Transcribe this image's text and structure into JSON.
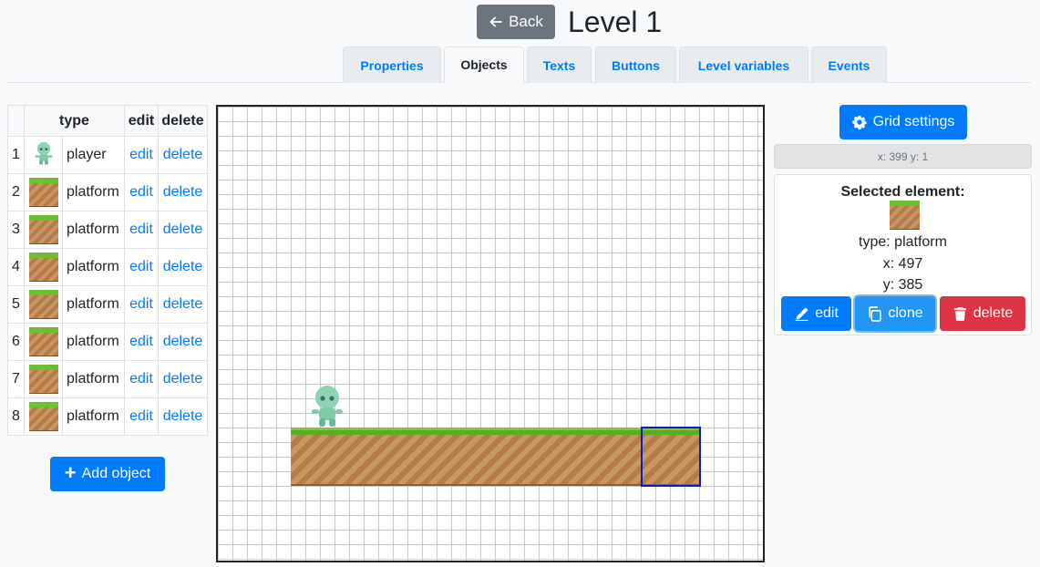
{
  "header": {
    "back_label": "Back",
    "title": "Level 1"
  },
  "tabs": [
    {
      "label": "Properties",
      "active": false
    },
    {
      "label": "Objects",
      "active": true
    },
    {
      "label": "Texts",
      "active": false
    },
    {
      "label": "Buttons",
      "active": false
    },
    {
      "label": "Level variables",
      "active": false
    },
    {
      "label": "Events",
      "active": false
    }
  ],
  "objects_table": {
    "columns": [
      "",
      "type",
      "edit",
      "delete"
    ],
    "rows": [
      {
        "num": "1",
        "icon": "player-icon",
        "type": "player",
        "edit": "edit",
        "delete": "delete"
      },
      {
        "num": "2",
        "icon": "platform-tile-icon",
        "type": "platform",
        "edit": "edit",
        "delete": "delete"
      },
      {
        "num": "3",
        "icon": "platform-tile-icon",
        "type": "platform",
        "edit": "edit",
        "delete": "delete"
      },
      {
        "num": "4",
        "icon": "platform-tile-icon",
        "type": "platform",
        "edit": "edit",
        "delete": "delete"
      },
      {
        "num": "5",
        "icon": "platform-tile-icon",
        "type": "platform",
        "edit": "edit",
        "delete": "delete"
      },
      {
        "num": "6",
        "icon": "platform-tile-icon",
        "type": "platform",
        "edit": "edit",
        "delete": "delete"
      },
      {
        "num": "7",
        "icon": "platform-tile-icon",
        "type": "platform",
        "edit": "edit",
        "delete": "delete"
      },
      {
        "num": "8",
        "icon": "platform-tile-icon",
        "type": "platform",
        "edit": "edit",
        "delete": "delete"
      }
    ]
  },
  "add_object_label": "Add object",
  "grid_settings_label": "Grid settings",
  "cursor_coords": "x: 399 y: 1",
  "selected": {
    "title": "Selected element:",
    "icon": "platform-tile-icon",
    "type_text": "type: platform",
    "x_text": "x: 497",
    "y_text": "y: 385",
    "edit_label": "edit",
    "clone_label": "clone",
    "delete_label": "delete"
  },
  "colors": {
    "primary": "#007bff",
    "secondary": "#6c757d",
    "danger": "#dc3545",
    "selection": "#0a1ec8"
  }
}
